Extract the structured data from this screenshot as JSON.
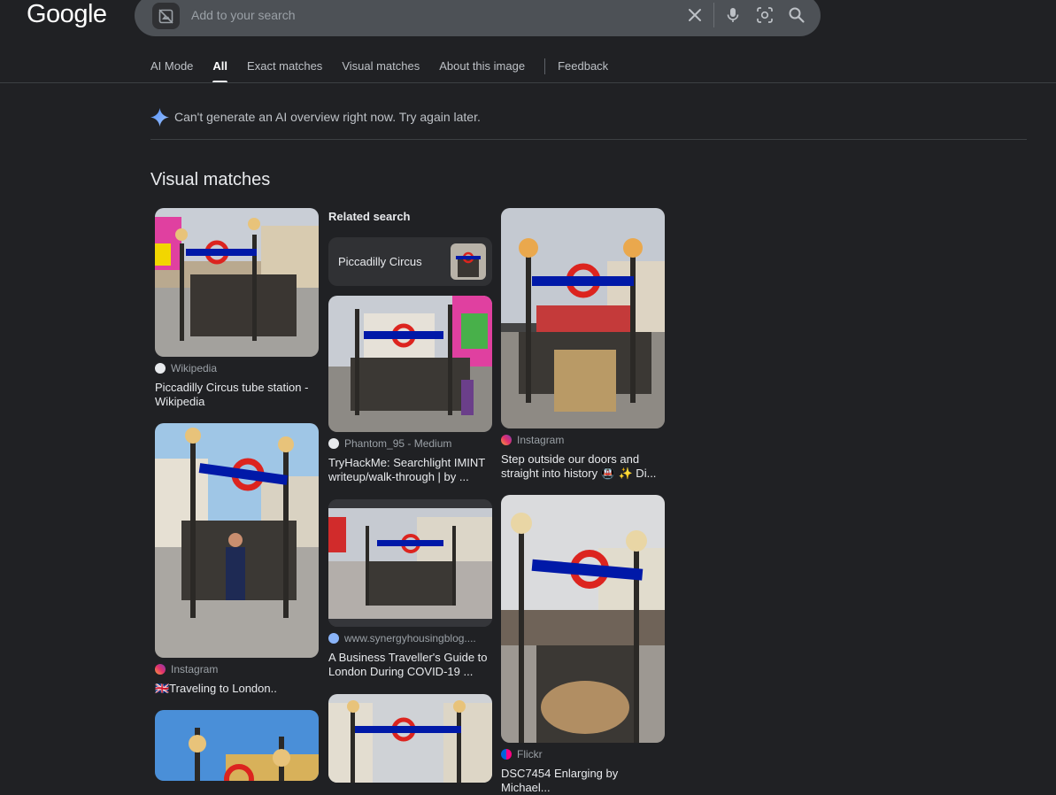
{
  "logo": "Google",
  "search": {
    "placeholder": "Add to your search",
    "icons": [
      "image-thumb-icon",
      "close-icon",
      "mic-icon",
      "lens-icon",
      "search-icon"
    ]
  },
  "tabs": [
    {
      "label": "AI Mode",
      "active": false
    },
    {
      "label": "All",
      "active": true
    },
    {
      "label": "Exact matches",
      "active": false
    },
    {
      "label": "Visual matches",
      "active": false
    },
    {
      "label": "About this image",
      "active": false
    },
    {
      "label": "Feedback",
      "active": false
    }
  ],
  "ai_overview": {
    "message": "Can't generate an AI overview right now. Try again later."
  },
  "section_title": "Visual matches",
  "related": {
    "heading": "Related search",
    "chip_label": "Piccadilly Circus"
  },
  "results": [
    {
      "source": "Wikipedia",
      "title": "Piccadilly Circus tube station - Wikipedia"
    },
    {
      "source": "Instagram",
      "title": "🇬🇧Traveling to London.."
    },
    {
      "source": "Phantom_95 - Medium",
      "title": "TryHackMe: Searchlight IMINT writeup/walk-through | by ..."
    },
    {
      "source": "www.synergyhousingblog....",
      "title": "A Business Traveller's Guide to London During COVID-19 ..."
    },
    {
      "source": "Instagram",
      "title": "Step outside our doors and straight into history 🚇 ✨ Di..."
    },
    {
      "source": "Flickr",
      "title": "DSC7454 Enlarging by Michael..."
    }
  ],
  "colors": {
    "background": "#202124",
    "searchbar": "#4d5156",
    "roundel_red": "#dc241f",
    "roundel_blue": "#0019a8"
  }
}
